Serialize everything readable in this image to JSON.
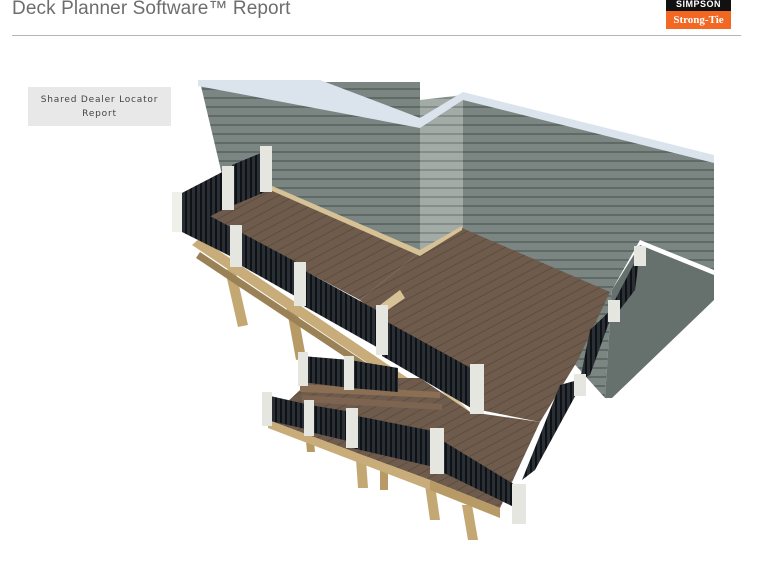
{
  "header": {
    "title": "Deck Planner Software™ Report"
  },
  "logo": {
    "top_text": "SIMPSON",
    "bottom_text": "Strong-Tie",
    "colors": {
      "top": "#111111",
      "bottom": "#f26722"
    }
  },
  "dealer_button": {
    "label": "Shared Dealer Locator Report"
  },
  "render": {
    "icon": "deck-3d-render",
    "colors": {
      "siding": "#7b8682",
      "decking": "#6e5b4c",
      "railing": "#20252b",
      "post_sleeve": "#e6e6e0",
      "framing": "#c4a874"
    }
  }
}
